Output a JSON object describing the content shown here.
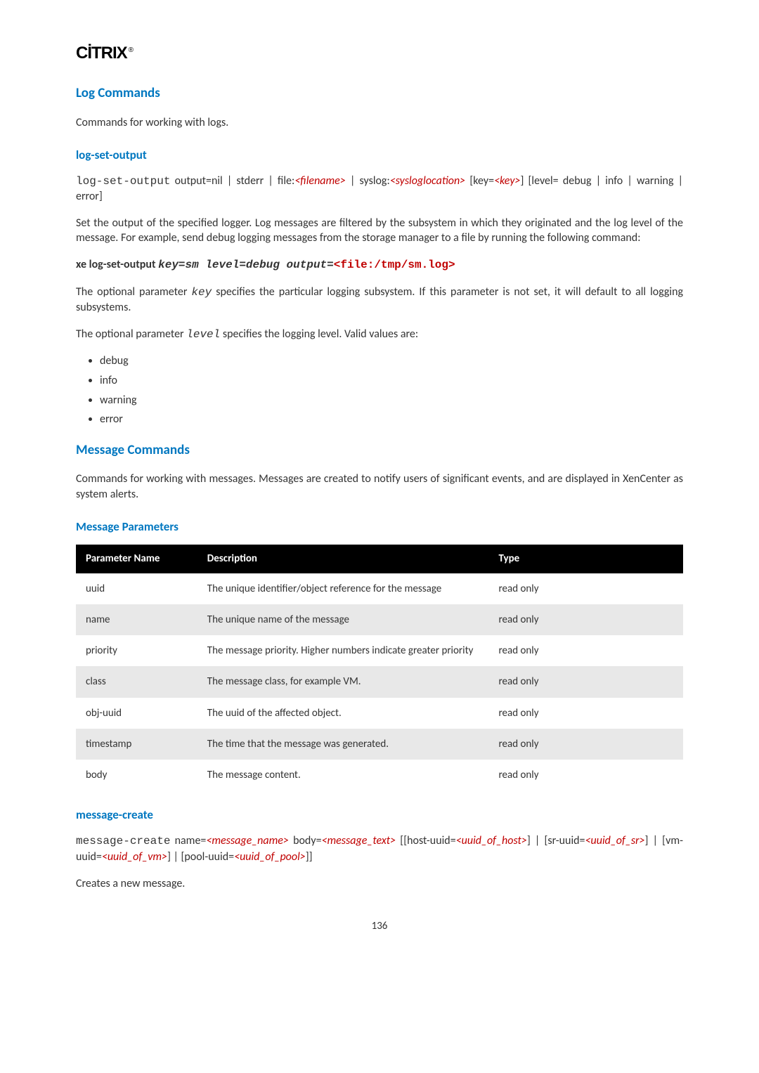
{
  "logo": "CİTRIX",
  "page_number": "136",
  "section_log": {
    "title": "Log Commands",
    "intro": "Commands for working with logs.",
    "cmd_heading": "log-set-output",
    "syntax_parts": {
      "cmd": "log-set-output",
      "a1": " output=nil | stderr | file:",
      "arg1": "<filename>",
      "a2": " | syslog:",
      "arg2": "<sysloglocation>",
      "a3": " [key=",
      "arg3": "<key>",
      "a4": "] [level= debug | info | warning | error]"
    },
    "desc": "Set the output of the specified logger. Log messages are filtered by the subsystem in which they originated and the log level of the message. For example, send debug logging messages from the storage manager to a file by running the following command:",
    "example": {
      "prefix": "xe log-set-output ",
      "args": "key=sm level=debug output=",
      "red": "<file:/tmp/sm.log>"
    },
    "key_desc_a": "The optional parameter ",
    "key_code": "key",
    "key_desc_b": " specifies the particular logging subsystem. If this parameter is not set, it will default to all logging subsystems.",
    "level_desc_a": "The optional parameter ",
    "level_code": "level",
    "level_desc_b": " specifies the logging level. Valid values are:",
    "levels": [
      "debug",
      "info",
      "warning",
      "error"
    ]
  },
  "section_msg": {
    "title": "Message Commands",
    "intro": "Commands for working with messages. Messages are created to notify users of significant events, and are displayed in XenCenter as system alerts.",
    "params_heading": "Message Parameters",
    "table": {
      "headers": [
        "Parameter Name",
        "Description",
        "Type"
      ],
      "rows": [
        {
          "name": "uuid",
          "desc": "The unique identifier/object reference for the message",
          "type": "read only"
        },
        {
          "name": "name",
          "desc": "The unique name of the message",
          "type": "read only"
        },
        {
          "name": "priority",
          "desc": "The message priority. Higher numbers indicate greater priority",
          "type": "read only"
        },
        {
          "name": "class",
          "desc": "The message class, for example VM.",
          "type": "read only"
        },
        {
          "name": "obj-uuid",
          "desc": "The uuid of the affected object.",
          "type": "read only"
        },
        {
          "name": "timestamp",
          "desc": "The time that the message was generated.",
          "type": "read only"
        },
        {
          "name": "body",
          "desc": "The message content.",
          "type": "read only"
        }
      ]
    },
    "create_heading": "message-create",
    "create_syntax": {
      "cmd": "message-create",
      "p1": " name=",
      "a1": "<message_name>",
      "p2": " body=",
      "a2": "<message_text>",
      "p3": " [[host-uuid=",
      "a3": "<uuid_of_host>",
      "p4": "] | [sr-uuid=",
      "a4": "<uuid_of_sr>",
      "p5": "] | [vm-uuid=",
      "a5": "<uuid_of_vm>",
      "p6": "] | [pool-uuid=",
      "a6": "<uuid_of_pool>",
      "p7": "]]"
    },
    "create_desc": "Creates a new message."
  }
}
